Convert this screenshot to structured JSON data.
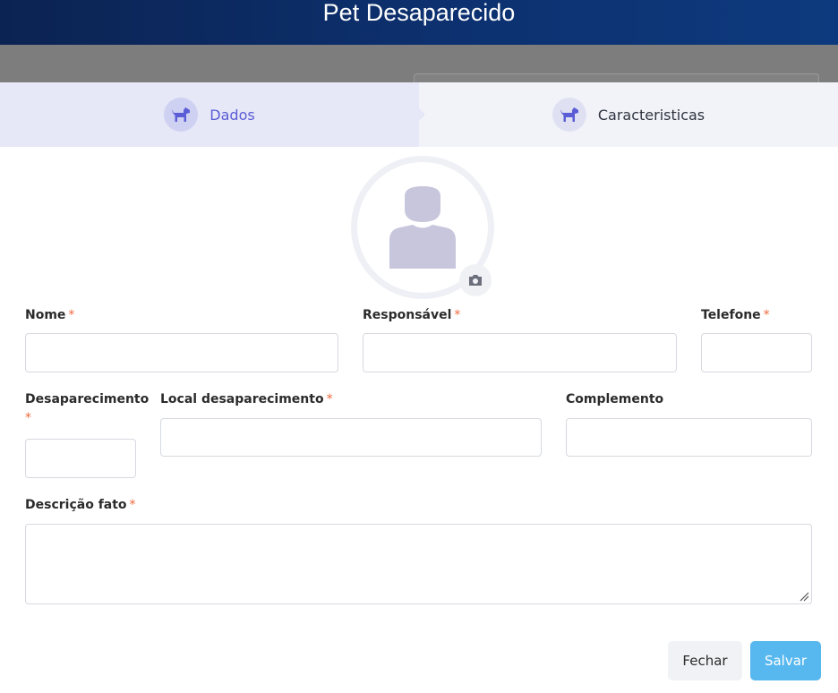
{
  "header": {
    "title": "Pet Desaparecido"
  },
  "stepper": {
    "steps": [
      {
        "label": "Dados",
        "icon": "dog-icon",
        "active": true
      },
      {
        "label": "Caracteristicas",
        "icon": "dog-icon",
        "active": false
      }
    ]
  },
  "avatar": {
    "icon": "user-placeholder-icon",
    "upload_icon": "camera-icon"
  },
  "form": {
    "required_mark": "*",
    "nome": {
      "label": "Nome",
      "value": ""
    },
    "responsavel": {
      "label": "Responsável",
      "value": ""
    },
    "telefone": {
      "label": "Telefone",
      "value": ""
    },
    "desaparecimento": {
      "label": "Desaparecimento",
      "value": ""
    },
    "local_desaparecimento": {
      "label": "Local desaparecimento",
      "value": ""
    },
    "complemento": {
      "label": "Complemento",
      "value": ""
    },
    "descricao_fato": {
      "label": "Descrição fato",
      "value": ""
    }
  },
  "actions": {
    "fechar": "Fechar",
    "salvar": "Salvar"
  },
  "colors": {
    "header": "#0d3170",
    "active_step": "#5b5dd6",
    "required": "#f0683c",
    "primary_button": "#57b8ef"
  }
}
